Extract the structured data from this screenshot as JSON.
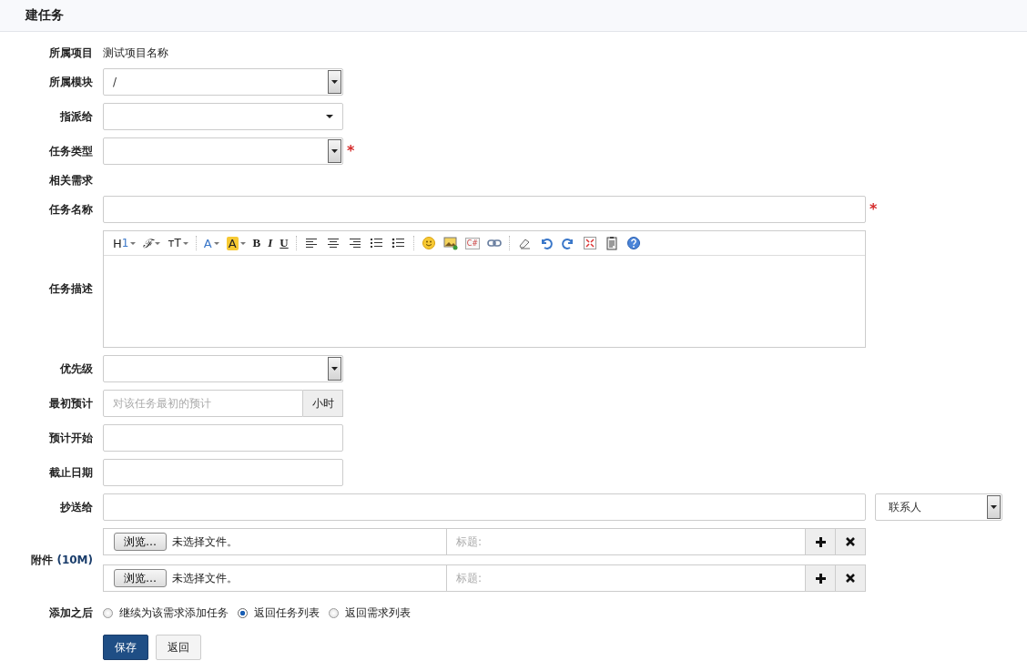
{
  "page_title": "建任务",
  "fields": [
    {
      "kind": "static",
      "label": "所属项目",
      "value": "测试项目名称"
    },
    {
      "kind": "select",
      "label": "所属模块",
      "value": "/"
    },
    {
      "kind": "chosen",
      "label": "指派给"
    },
    {
      "kind": "select",
      "label": "任务类型",
      "required_mark": "*"
    },
    {
      "kind": "none",
      "label": "相关需求"
    },
    {
      "kind": "wide",
      "label": "任务名称",
      "required_mark": "*"
    },
    {
      "kind": "editor",
      "label": "任务描述",
      "toolbar": [
        [
          {
            "kind": "heading",
            "label": "H",
            "sub": "1"
          },
          {
            "kind": "script",
            "label": "ℱ"
          },
          {
            "kind": "size",
            "label": "ᴛT"
          }
        ],
        [
          {
            "kind": "fontcolor",
            "label": "A"
          },
          {
            "kind": "highlight",
            "label": "A"
          },
          {
            "kind": "bold",
            "label": "B"
          },
          {
            "kind": "italic",
            "label": "I"
          },
          {
            "kind": "underline",
            "label": "U"
          }
        ],
        [
          {
            "kind": "alignleft"
          },
          {
            "kind": "aligncenter"
          },
          {
            "kind": "alignright"
          },
          {
            "kind": "orderedlist"
          },
          {
            "kind": "bulletlist"
          }
        ],
        [
          {
            "kind": "smiley"
          },
          {
            "kind": "image"
          },
          {
            "kind": "code",
            "label": "C#"
          },
          {
            "kind": "link"
          }
        ],
        [
          {
            "kind": "eraser"
          },
          {
            "kind": "undo"
          },
          {
            "kind": "redo"
          },
          {
            "kind": "fullscreen"
          },
          {
            "kind": "clipboard"
          },
          {
            "kind": "help"
          }
        ]
      ]
    },
    {
      "kind": "select",
      "label": "优先级"
    },
    {
      "kind": "addon",
      "label": "最初预计",
      "placeholder": "对该任务最初的预计",
      "addon": "小时"
    },
    {
      "kind": "text",
      "label": "预计开始"
    },
    {
      "kind": "text",
      "label": "截止日期"
    },
    {
      "kind": "mailto",
      "label": "抄送给",
      "contact": "联系人"
    },
    {
      "kind": "files",
      "label": "附件",
      "note": "(10M)",
      "files": [
        {
          "browse": "浏览…",
          "status": "未选择文件。",
          "title_placeholder": "标题:"
        },
        {
          "browse": "浏览…",
          "status": "未选择文件。",
          "title_placeholder": "标题:"
        }
      ]
    },
    {
      "kind": "radios",
      "label": "添加之后",
      "options": [
        {
          "label": "继续为该需求添加任务",
          "selected": false
        },
        {
          "label": "返回任务列表",
          "selected": true
        },
        {
          "label": "返回需求列表",
          "selected": false
        }
      ]
    }
  ],
  "buttons": [
    {
      "label": "保存",
      "primary": true
    },
    {
      "label": "返回",
      "primary": false
    }
  ]
}
